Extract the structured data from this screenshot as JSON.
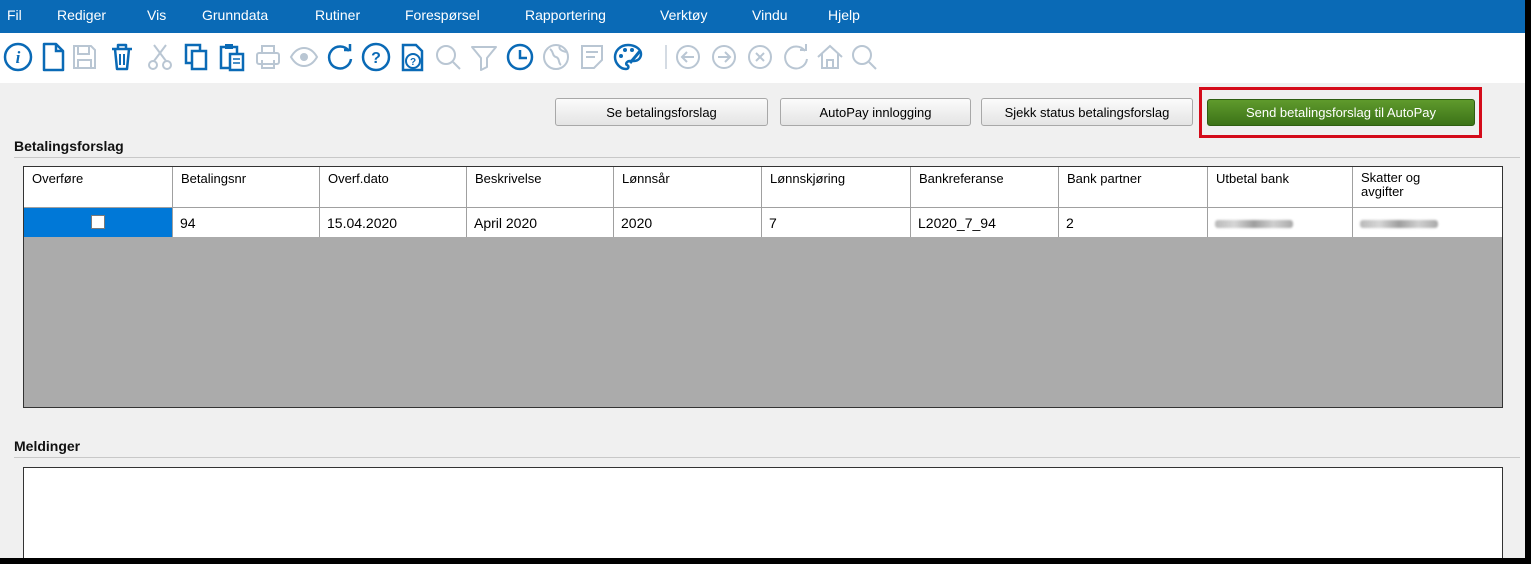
{
  "menu": [
    "Fil",
    "Rediger",
    "Vis",
    "Grunndata",
    "Rutiner",
    "Forespørsel",
    "Rapportering",
    "Verktøy",
    "Vindu",
    "Hjelp"
  ],
  "toolbar_icons": [
    "info-icon",
    "new-document-icon",
    "save-icon",
    "delete-icon",
    "cut-icon",
    "copy-icon",
    "paste-icon",
    "print-icon",
    "preview-icon",
    "refresh-icon",
    "help-icon",
    "help-document-icon",
    "search-icon",
    "filter-icon",
    "history-icon",
    "globe-icon",
    "note-icon",
    "palette-icon",
    "back-icon",
    "forward-icon",
    "cancel-icon",
    "reload-icon",
    "home-icon",
    "zoom-icon"
  ],
  "actions": {
    "see_proposal": "Se betalingsforslag",
    "autopay_login": "AutoPay innlogging",
    "check_status": "Sjekk status betalingsforslag",
    "send_proposal": "Send betalingsforslag til AutoPay"
  },
  "sections": {
    "proposals": "Betalingsforslag",
    "messages": "Meldinger"
  },
  "grid": {
    "columns": [
      "Overføre",
      "Betalingsnr",
      "Overf.dato",
      "Beskrivelse",
      "Lønnsår",
      "Lønnskjøring",
      "Bankreferanse",
      "Bank partner",
      "Utbetal bank",
      "Skatter og avgifter"
    ],
    "rows": [
      {
        "transfer": false,
        "payment_no": "94",
        "transfer_date": "15.04.2020",
        "description": "April 2020",
        "salary_year": "2020",
        "payroll_run": "7",
        "bank_reference": "L2020_7_94",
        "bank_partner": "2"
      }
    ]
  },
  "colors": {
    "menubar": "#0a6ab6",
    "send_button": "#4a8321",
    "highlight": "#d40b1a",
    "selected_cell": "#0078d7"
  }
}
